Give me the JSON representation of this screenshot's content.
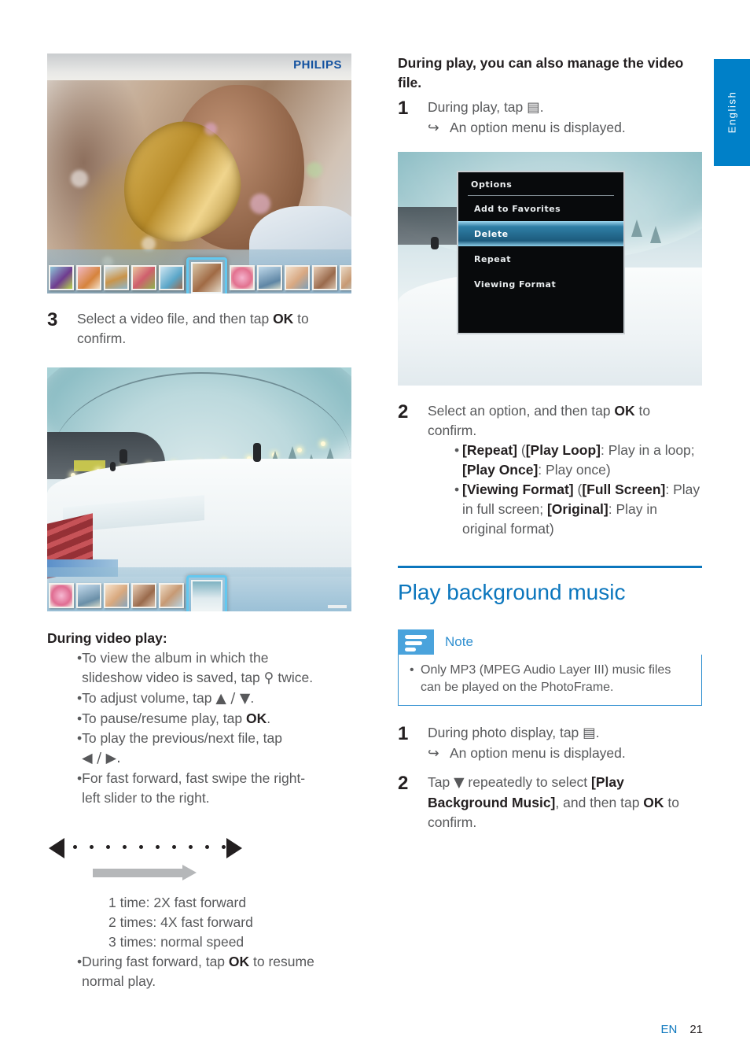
{
  "page": {
    "language_tab": "English",
    "footer_lang": "EN",
    "footer_page": "21"
  },
  "left_column": {
    "screenshot_party": {
      "brand_logo": "PHILIPS",
      "thumbnail_count": 11,
      "selected_index": 5
    },
    "step3": {
      "num": "3",
      "text_before": "Select a video file, and then tap ",
      "bold": "OK",
      "text_after": " to confirm."
    },
    "screenshot_video": {
      "thumbnail_count": 6,
      "selected_index": 5
    },
    "during_video_play_heading": "During video play",
    "during_video_play_heading_colon": ":",
    "bullets": [
      {
        "parts": [
          {
            "t": "To view the album in which the slideshow video is saved, tap ",
            "b": false
          },
          {
            "t": "⌘",
            "b": false,
            "icon": "zoom-out-icon"
          },
          {
            "t": " twice.",
            "b": false
          }
        ],
        "plain": "To view the album in which the slideshow video is saved, tap ⚲ twice."
      },
      {
        "plain": "To adjust volume, tap ▲ / ▼."
      },
      {
        "plain": "To pause/resume play, tap OK."
      },
      {
        "plain": "To play the previous/next file, tap ◀ / ▶."
      },
      {
        "plain": "For fast forward, fast swipe the right-left slider to the right."
      }
    ],
    "bullet1_a": "To view the album in which the",
    "bullet1_b_pre": "slideshow video is saved, tap ",
    "bullet1_b_icon": "⚲",
    "bullet1_b_post": " twice.",
    "bullet2_pre": "To adjust volume, tap ",
    "bullet2_icons": "▲ / ▼",
    "bullet2_post": ".",
    "bullet3_pre": "To pause/resume play, tap ",
    "bullet3_bold": "OK",
    "bullet3_post": ".",
    "bullet4_a": "To play the previous/next file, tap",
    "bullet4_b": "◀ / ▶.",
    "bullet5_a": "For fast forward, fast swipe the right-",
    "bullet5_b": "left slider to the right.",
    "slider_diagram": {
      "dot_count": 10,
      "left_arrow": "left-triangle-icon",
      "right_arrow": "right-triangle-icon",
      "direction_arrow": "gray-right-arrow-icon"
    },
    "speed_lines": [
      "1 time: 2X fast forward",
      "2 times: 4X fast forward",
      "3 times: normal speed"
    ],
    "bullet6_pre": "During fast forward, tap ",
    "bullet6_bold": "OK",
    "bullet6_post": " to resume normal play."
  },
  "right_column": {
    "intro": "During play, you can also manage the video file.",
    "step1": {
      "num": "1",
      "text_pre": "During play, tap ",
      "icon": "▤",
      "text_post": ".",
      "arrow": "↪",
      "result": "An option menu is displayed."
    },
    "screenshot_options": {
      "menu_title": "Options",
      "items": [
        {
          "label": "Add to Favorites",
          "selected": false
        },
        {
          "label": "Delete",
          "selected": true
        },
        {
          "label": "Repeat",
          "selected": false
        },
        {
          "label": "Viewing Format",
          "selected": false
        }
      ]
    },
    "step2": {
      "num": "2",
      "text_pre": "Select an option, and then tap ",
      "bold": "OK",
      "text_post": " to confirm.",
      "bullets": [
        {
          "b1": "[Repeat]",
          "t1": " (",
          "b2": "[Play Loop]",
          "t2": ": Play in a loop; ",
          "b3": "[Play Once]",
          "t3": ": Play once)"
        },
        {
          "b1": "[Viewing Format]",
          "t1": " (",
          "b2": "[Full Screen]",
          "t2": ": Play in full screen; ",
          "b3": "[Original]",
          "t3": ": Play in original format)"
        }
      ]
    },
    "section": {
      "title": "Play background music",
      "note_label": "Note",
      "note_text": "Only MP3 (MPEG Audio Layer III) music files can be played on the PhotoFrame."
    },
    "step_bgm_1": {
      "num": "1",
      "text_pre": "During photo display, tap ",
      "icon": "▤",
      "text_post": ".",
      "arrow": "↪",
      "result": "An option menu is displayed."
    },
    "step_bgm_2": {
      "num": "2",
      "text_pre": "Tap ",
      "icon": "▼",
      "text_mid": " repeatedly to select ",
      "bold": "[Play Background Music]",
      "text_post": ", and then tap ",
      "bold2": "OK",
      "text_end": " to confirm."
    }
  },
  "colors": {
    "accent_blue": "#0b76bd",
    "tab_blue": "#0080c8",
    "note_blue": "#4aa3dc",
    "body_gray": "#58595b",
    "heading_black": "#231f20"
  }
}
